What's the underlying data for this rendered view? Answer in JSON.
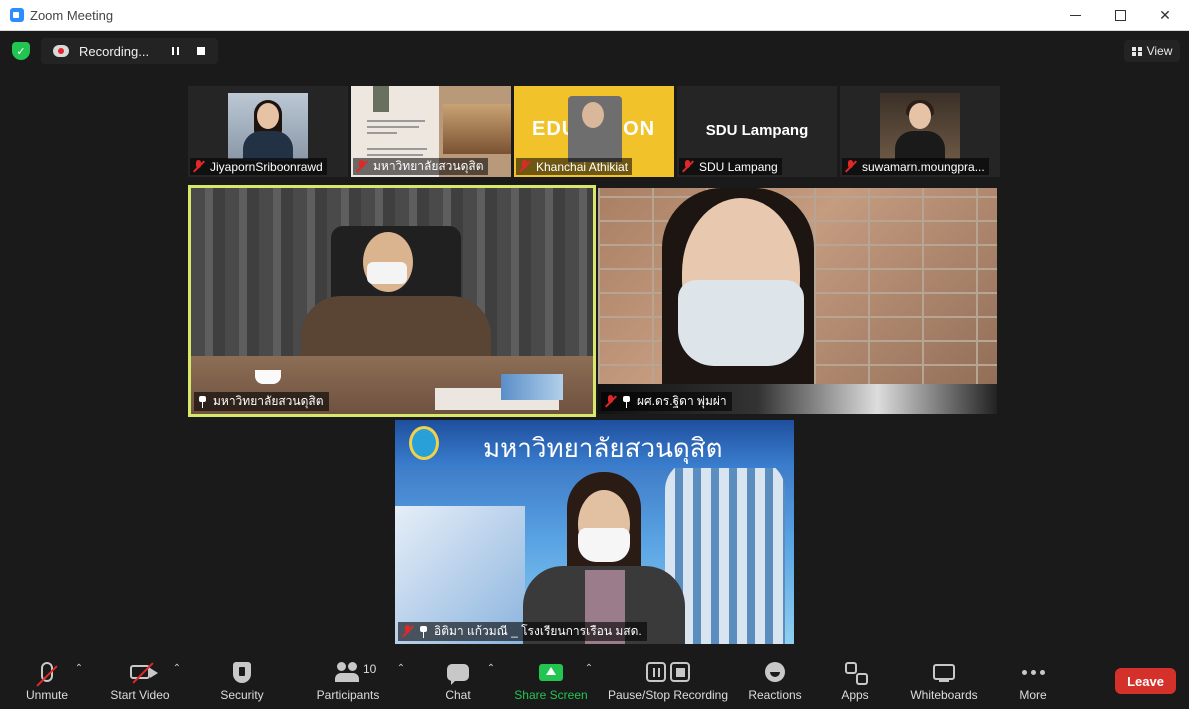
{
  "window": {
    "title": "Zoom Meeting"
  },
  "meeting_bar": {
    "recording_label": "Recording...",
    "view_label": "View"
  },
  "thumbnails": [
    {
      "name": "JiyapornSriboonrawd"
    },
    {
      "name": "มหาวิทยาลัยสวนดุสิต"
    },
    {
      "name": "Khanchai Athikiat"
    },
    {
      "name": "SDU Lampang",
      "card_text": "SDU Lampang"
    },
    {
      "name": "suwamarn.moungpra..."
    }
  ],
  "videos": [
    {
      "name": "มหาวิทยาลัยสวนดุสิต"
    },
    {
      "name": "ผศ.ดร.ฐิดา พุ่มผ่า"
    },
    {
      "name": "อิติมา แก้วมณี _ โรงเรียนการเรือน มสด.",
      "banner_text": "มหาวิทยาลัยสวนดุสิต"
    }
  ],
  "toolbar": {
    "unmute": "Unmute",
    "start_video": "Start Video",
    "security": "Security",
    "participants": "Participants",
    "participants_count": "10",
    "chat": "Chat",
    "share_screen": "Share Screen",
    "pause_stop_recording": "Pause/Stop Recording",
    "reactions": "Reactions",
    "apps": "Apps",
    "whiteboards": "Whiteboards",
    "more": "More",
    "leave": "Leave"
  },
  "colors": {
    "active_speaker_border": "#d8e86a",
    "share_green": "#23c552",
    "leave_red": "#d5312b",
    "muted_red": "#e02828"
  }
}
